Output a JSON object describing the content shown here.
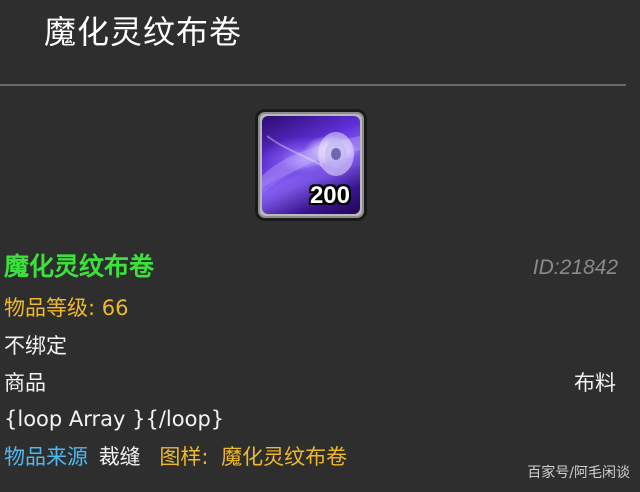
{
  "header": {
    "title": "魔化灵纹布卷"
  },
  "item": {
    "icon_name": "purple-cloth-bolt-icon",
    "stack_count": "200",
    "name": "魔化灵纹布卷",
    "name_color": "#3ae23a",
    "id_text": "ID:21842",
    "level_text": "物品等级: 66",
    "bind_text": "不绑定",
    "type_text": "商品",
    "subtype_text": "布料",
    "loop_text": "{loop Array }{/loop}",
    "source_label": "物品来源",
    "source_value": "裁缝",
    "pattern_label": "图样:",
    "pattern_value": "魔化灵纹布卷"
  },
  "colors": {
    "background": "#2e2e2e",
    "level": "#f0b928",
    "source": "#4fb8f0",
    "id": "#8a8a8a"
  },
  "watermark": {
    "text": "百家号/阿毛闲谈"
  }
}
